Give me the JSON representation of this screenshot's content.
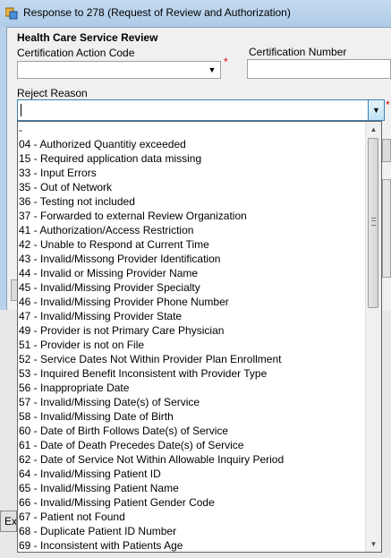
{
  "window": {
    "title": "Response to 278 (Request of Review and Authorization)"
  },
  "form": {
    "group_title": "Health Care Service Review",
    "certification_action_code": {
      "label": "Certification Action Code",
      "value": "",
      "required_marker": "*"
    },
    "certification_number": {
      "label": "Certification Number",
      "value": ""
    },
    "reject_reason": {
      "label": "Reject Reason",
      "value": "",
      "required_marker": "*"
    }
  },
  "dropdown": {
    "options": [
      "-",
      "04 - Authorized Quantitiy exceeded",
      "15 - Required application data missing",
      "33 - Input Errors",
      "35 - Out of Network",
      "36 - Testing not included",
      "37 - Forwarded to external Review Organization",
      "41 - Authorization/Access Restriction",
      "42 - Unable to Respond at Current Time",
      "43 - Invalid/Missong Provider Identification",
      "44 - Invalid or Missing Provider Name",
      "45 - Invalid/Missing Provider Specialty",
      "46 - Invalid/Missing Provider Phone Number",
      "47 - Invalid/Missing Provider State",
      "49 - Provider is not Primary Care Physician",
      "51 - Provider is not on File",
      "52 - Service Dates Not Within Provider Plan Enrollment",
      "53 - Inquired Benefit Inconsistent with Provider Type",
      "56 - Inappropriate Date",
      "57 - Invalid/Missing Date(s) of Service",
      "58 - Invalid/Missing Date of Birth",
      "60 - Date of Birth Follows Date(s) of Service",
      "61 - Date of Death Precedes Date(s) of Service",
      "62 - Date of Service Not Within Allowable Inquiry Period",
      "64 - Invalid/Missing Patient ID",
      "65 - Invalid/Missing Patient Name",
      "66 - Invalid/Missing Patient Gender Code",
      "67 - Patient not Found",
      "68 - Duplicate Patient ID Number",
      "69 - Inconsistent with Patients Age"
    ],
    "scrollbar": {
      "up_icon": "triangle-up-icon",
      "down_icon": "triangle-down-icon"
    }
  },
  "background": {
    "exit_button_fragment": "Ex"
  },
  "colors": {
    "title_bar": "#b9d1ea",
    "focus_border": "#3c7fb1",
    "required": "#e00000"
  }
}
